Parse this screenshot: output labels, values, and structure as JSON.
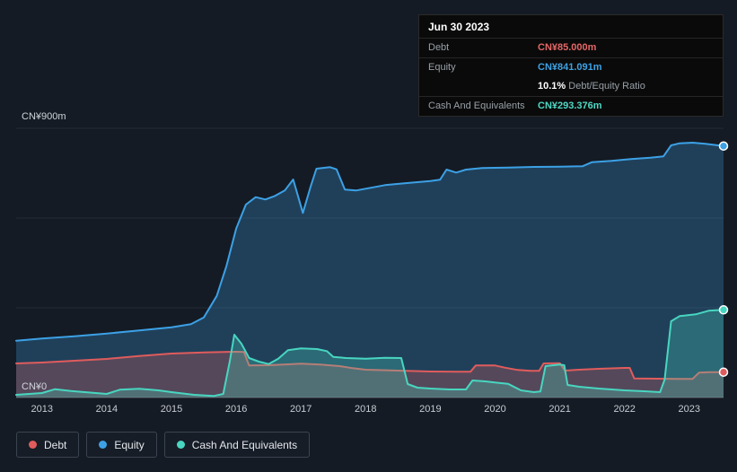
{
  "tooltip": {
    "date": "Jun 30 2023",
    "debt_label": "Debt",
    "debt_value": "CN¥85.000m",
    "equity_label": "Equity",
    "equity_value": "CN¥841.091m",
    "ratio_value": "10.1%",
    "ratio_label": "Debt/Equity Ratio",
    "cash_label": "Cash And Equivalents",
    "cash_value": "CN¥293.376m"
  },
  "axis": {
    "y_top_label": "CN¥900m",
    "y_zero_label": "CN¥0"
  },
  "legend": [
    {
      "id": "debt",
      "label": "Debt",
      "color": "#e05c5c"
    },
    {
      "id": "equity",
      "label": "Equity",
      "color": "#3ca1e6"
    },
    {
      "id": "cash",
      "label": "Cash And Equivalents",
      "color": "#48d6c0"
    }
  ],
  "colors": {
    "background": "#151b24",
    "debt": "#e05c5c",
    "equity": "#3ca1e6",
    "cash": "#48d6c0",
    "gridline": "rgba(255,255,255,0.07)",
    "zero_line": "rgba(255,255,255,0.28)"
  },
  "chart_data": {
    "type": "area",
    "title": "",
    "xlabel": "",
    "ylabel": "CN¥ (millions)",
    "xlim": [
      2012.6,
      2023.53
    ],
    "ylim": [
      0,
      900
    ],
    "x_ticks": [
      2013,
      2014,
      2015,
      2016,
      2017,
      2018,
      2019,
      2020,
      2021,
      2022,
      2023
    ],
    "y_gridlines": [
      0,
      300,
      600,
      900
    ],
    "legend_position": "bottom-left",
    "series": [
      {
        "name": "Equity",
        "color": "#3ca1e6",
        "final_value": 841.091,
        "points": [
          [
            2012.6,
            190
          ],
          [
            2013,
            197
          ],
          [
            2013.5,
            205
          ],
          [
            2014,
            214
          ],
          [
            2014.5,
            224
          ],
          [
            2015,
            235
          ],
          [
            2015.3,
            245
          ],
          [
            2015.5,
            268
          ],
          [
            2015.7,
            340
          ],
          [
            2015.85,
            440
          ],
          [
            2016,
            565
          ],
          [
            2016.15,
            645
          ],
          [
            2016.3,
            670
          ],
          [
            2016.45,
            662
          ],
          [
            2016.6,
            674
          ],
          [
            2016.75,
            692
          ],
          [
            2016.88,
            729
          ],
          [
            2017.03,
            617
          ],
          [
            2017.15,
            705
          ],
          [
            2017.24,
            765
          ],
          [
            2017.45,
            770
          ],
          [
            2017.55,
            763
          ],
          [
            2017.68,
            695
          ],
          [
            2017.85,
            692
          ],
          [
            2018,
            698
          ],
          [
            2018.3,
            710
          ],
          [
            2018.6,
            716
          ],
          [
            2019,
            724
          ],
          [
            2019.15,
            728
          ],
          [
            2019.25,
            762
          ],
          [
            2019.4,
            752
          ],
          [
            2019.55,
            762
          ],
          [
            2019.8,
            767
          ],
          [
            2020.2,
            769
          ],
          [
            2020.6,
            771
          ],
          [
            2021,
            772
          ],
          [
            2021.35,
            773
          ],
          [
            2021.5,
            787
          ],
          [
            2021.8,
            791
          ],
          [
            2022.1,
            797
          ],
          [
            2022.4,
            802
          ],
          [
            2022.6,
            806
          ],
          [
            2022.72,
            843
          ],
          [
            2022.85,
            850
          ],
          [
            2023.05,
            852
          ],
          [
            2023.25,
            848
          ],
          [
            2023.53,
            841
          ]
        ]
      },
      {
        "name": "Debt",
        "color": "#e05c5c",
        "final_value": 85.0,
        "points": [
          [
            2012.6,
            114
          ],
          [
            2013,
            117
          ],
          [
            2013.5,
            123
          ],
          [
            2014,
            129
          ],
          [
            2014.5,
            139
          ],
          [
            2015,
            147
          ],
          [
            2015.5,
            151
          ],
          [
            2016,
            153
          ],
          [
            2016.12,
            152
          ],
          [
            2016.2,
            107
          ],
          [
            2016.5,
            108
          ],
          [
            2016.8,
            111
          ],
          [
            2017,
            113
          ],
          [
            2017.3,
            110
          ],
          [
            2017.6,
            105
          ],
          [
            2017.8,
            98
          ],
          [
            2018,
            93
          ],
          [
            2018.5,
            90
          ],
          [
            2019,
            87
          ],
          [
            2019.5,
            86
          ],
          [
            2019.62,
            86
          ],
          [
            2019.7,
            107
          ],
          [
            2020,
            107
          ],
          [
            2020.15,
            100
          ],
          [
            2020.35,
            92
          ],
          [
            2020.55,
            89
          ],
          [
            2020.68,
            89
          ],
          [
            2020.75,
            114
          ],
          [
            2021,
            115
          ],
          [
            2021.08,
            90
          ],
          [
            2021.3,
            93
          ],
          [
            2021.6,
            96
          ],
          [
            2022,
            99
          ],
          [
            2022.08,
            99
          ],
          [
            2022.15,
            64
          ],
          [
            2022.5,
            63
          ],
          [
            2022.8,
            62
          ],
          [
            2023.05,
            62
          ],
          [
            2023.15,
            83
          ],
          [
            2023.3,
            85
          ],
          [
            2023.53,
            85
          ]
        ]
      },
      {
        "name": "Cash And Equivalents",
        "color": "#48d6c0",
        "final_value": 293.376,
        "points": [
          [
            2012.6,
            9
          ],
          [
            2013,
            15
          ],
          [
            2013.2,
            28
          ],
          [
            2013.45,
            22
          ],
          [
            2014,
            12
          ],
          [
            2014.2,
            26
          ],
          [
            2014.5,
            29
          ],
          [
            2014.8,
            24
          ],
          [
            2015,
            18
          ],
          [
            2015.35,
            9
          ],
          [
            2015.65,
            5
          ],
          [
            2015.8,
            12
          ],
          [
            2015.9,
            120
          ],
          [
            2015.97,
            210
          ],
          [
            2016.08,
            180
          ],
          [
            2016.2,
            132
          ],
          [
            2016.35,
            120
          ],
          [
            2016.5,
            112
          ],
          [
            2016.65,
            130
          ],
          [
            2016.8,
            158
          ],
          [
            2017,
            164
          ],
          [
            2017.25,
            162
          ],
          [
            2017.4,
            155
          ],
          [
            2017.5,
            136
          ],
          [
            2017.7,
            132
          ],
          [
            2018,
            130
          ],
          [
            2018.3,
            133
          ],
          [
            2018.55,
            132
          ],
          [
            2018.65,
            45
          ],
          [
            2018.8,
            33
          ],
          [
            2019,
            30
          ],
          [
            2019.3,
            27
          ],
          [
            2019.55,
            27
          ],
          [
            2019.65,
            57
          ],
          [
            2019.85,
            54
          ],
          [
            2020,
            50
          ],
          [
            2020.2,
            46
          ],
          [
            2020.4,
            24
          ],
          [
            2020.6,
            18
          ],
          [
            2020.7,
            20
          ],
          [
            2020.78,
            105
          ],
          [
            2021,
            110
          ],
          [
            2021.07,
            108
          ],
          [
            2021.12,
            42
          ],
          [
            2021.3,
            36
          ],
          [
            2021.6,
            30
          ],
          [
            2022,
            24
          ],
          [
            2022.3,
            21
          ],
          [
            2022.55,
            18
          ],
          [
            2022.62,
            60
          ],
          [
            2022.72,
            255
          ],
          [
            2022.85,
            272
          ],
          [
            2023.1,
            278
          ],
          [
            2023.3,
            290
          ],
          [
            2023.53,
            293
          ]
        ]
      }
    ]
  }
}
